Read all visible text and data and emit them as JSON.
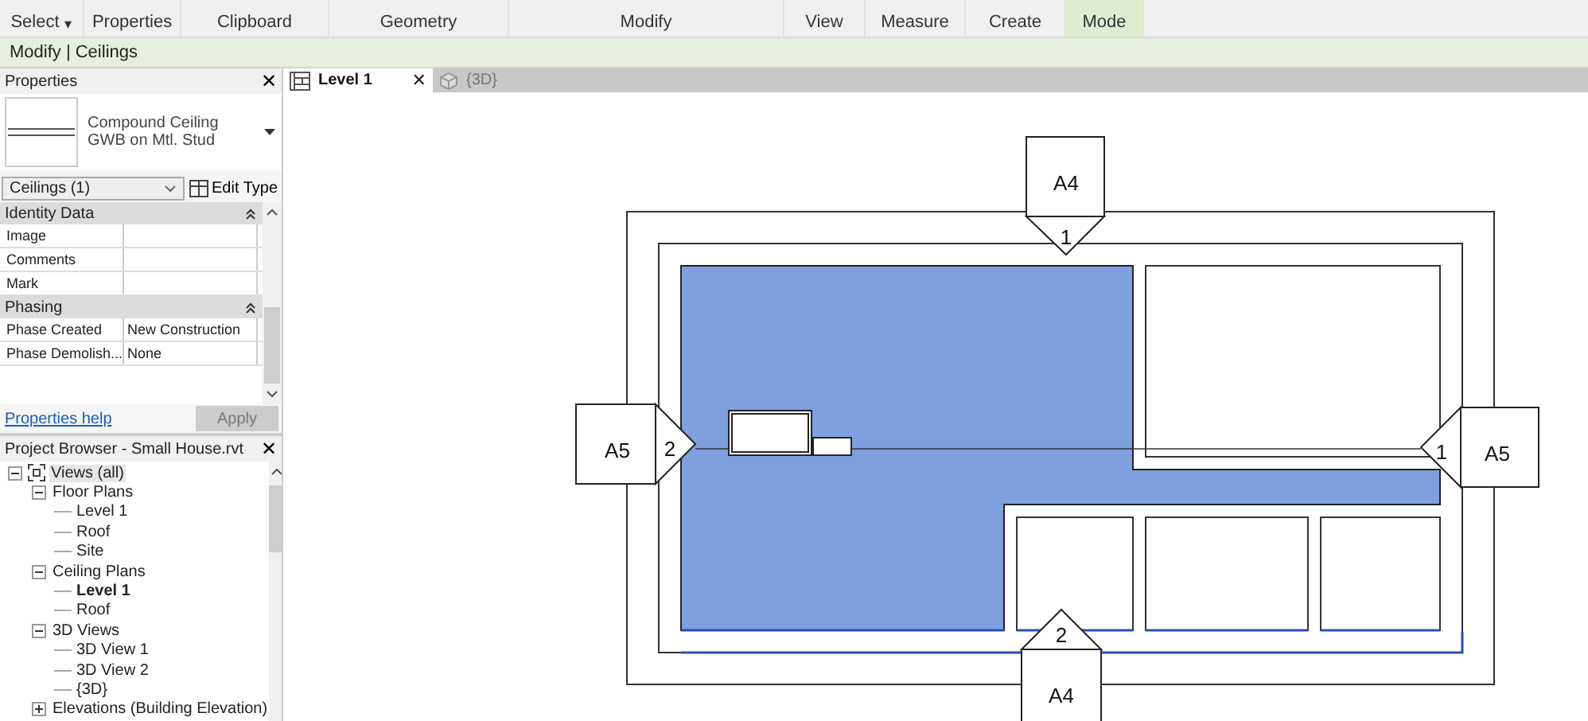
{
  "ribbon": {
    "panels": [
      {
        "label": "Select",
        "caret": "▾",
        "contextual": false
      },
      {
        "label": "Properties",
        "contextual": false
      },
      {
        "label": "Clipboard",
        "contextual": false
      },
      {
        "label": "Geometry",
        "contextual": false
      },
      {
        "label": "Modify",
        "contextual": false
      },
      {
        "label": "View",
        "contextual": false
      },
      {
        "label": "Measure",
        "contextual": false
      },
      {
        "label": "Create",
        "contextual": false
      },
      {
        "label": "Mode",
        "contextual": true
      }
    ]
  },
  "context_bar": {
    "title": "Modify | Ceilings"
  },
  "properties": {
    "title": "Properties",
    "close": "✕",
    "type": {
      "name": "Compound Ceiling",
      "subname": "GWB on Mtl. Stud"
    },
    "filter": "Ceilings (1)",
    "edit_type": "Edit Type",
    "groups": [
      {
        "title": "Identity Data",
        "rows": [
          {
            "name": "Image"
          },
          {
            "name": "Comments"
          },
          {
            "name": "Mark"
          }
        ]
      },
      {
        "title": "Phasing",
        "rows": [
          {
            "name": "Phase Created",
            "value": "New Construction"
          },
          {
            "name": "Phase Demolish...",
            "value": "None"
          }
        ]
      }
    ],
    "help": "Properties help",
    "apply": {
      "label": "Apply",
      "disabled": true
    }
  },
  "browser": {
    "title": "Project Browser - Small House.rvt",
    "close": "✕",
    "tree": [
      {
        "label": "Views (all)",
        "expanded": true,
        "selected": false,
        "children": [
          {
            "label": "Floor Plans",
            "expanded": true,
            "selected": false,
            "children": [
              {
                "label": "Level 1",
                "selected": false
              },
              {
                "label": "Roof",
                "selected": false
              },
              {
                "label": "Site",
                "selected": false
              }
            ]
          },
          {
            "label": "Ceiling Plans",
            "expanded": true,
            "selected": false,
            "children": [
              {
                "label": "Level 1",
                "selected": true
              },
              {
                "label": "Roof",
                "selected": false
              }
            ]
          },
          {
            "label": "3D Views",
            "expanded": true,
            "selected": false,
            "children": [
              {
                "label": "3D View 1",
                "selected": false
              },
              {
                "label": "3D View 2",
                "selected": false
              },
              {
                "label": "{3D}",
                "selected": false
              }
            ]
          },
          {
            "label": "Elevations (Building Elevation)",
            "expanded": false,
            "selected": false
          }
        ]
      }
    ]
  },
  "tabs": [
    {
      "label": "Level 1",
      "selected": true,
      "close": "✕"
    },
    {
      "label": "{3D}",
      "selected": false
    }
  ],
  "plan": {
    "markers": [
      {
        "sheet": "A4",
        "number": "1"
      },
      {
        "sheet": "A4",
        "number": "2"
      },
      {
        "sheet": "A5",
        "number": "2"
      },
      {
        "sheet": "A5",
        "number": "1"
      }
    ]
  }
}
